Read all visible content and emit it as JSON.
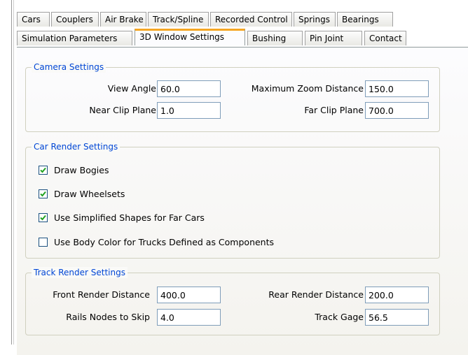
{
  "tabs": {
    "row1": [
      "Cars",
      "Couplers",
      "Air Brake",
      "Track/Spline",
      "Recorded Control",
      "Springs",
      "Bearings"
    ],
    "row2": [
      "Simulation Parameters",
      "3D Window Settings",
      "Bushing",
      "Pin Joint",
      "Contact"
    ],
    "active": "3D Window Settings"
  },
  "camera": {
    "legend": "Camera Settings",
    "view_angle_label": "View Angle",
    "view_angle_value": "60.0",
    "max_zoom_label": "Maximum Zoom Distance",
    "max_zoom_value": "150.0",
    "near_clip_label": "Near Clip Plane",
    "near_clip_value": "1.0",
    "far_clip_label": "Far Clip Plane",
    "far_clip_value": "700.0"
  },
  "car_render": {
    "legend": "Car Render Settings",
    "options": [
      {
        "label": "Draw Bogies",
        "checked": true
      },
      {
        "label": "Draw Wheelsets",
        "checked": true
      },
      {
        "label": "Use Simplified Shapes for Far Cars",
        "checked": true
      },
      {
        "label": "Use Body Color for Trucks Defined as Components",
        "checked": false
      }
    ]
  },
  "track_render": {
    "legend": "Track Render Settings",
    "front_label": "Front Render Distance",
    "front_value": "400.0",
    "rear_label": "Rear Render Distance",
    "rear_value": "200.0",
    "skip_label": "Rails Nodes to Skip",
    "skip_value": "4.0",
    "gage_label": "Track Gage",
    "gage_value": "56.5"
  },
  "colors": {
    "accent": "#f5a623",
    "legend": "#0046d5",
    "check": "#21a121"
  }
}
